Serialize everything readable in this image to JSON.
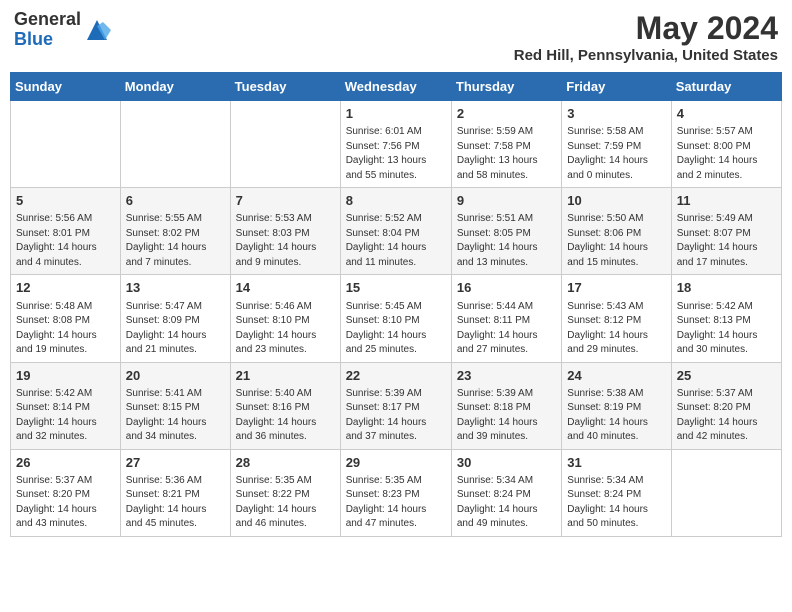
{
  "header": {
    "logo_general": "General",
    "logo_blue": "Blue",
    "month_year": "May 2024",
    "location": "Red Hill, Pennsylvania, United States"
  },
  "days_of_week": [
    "Sunday",
    "Monday",
    "Tuesday",
    "Wednesday",
    "Thursday",
    "Friday",
    "Saturday"
  ],
  "weeks": [
    [
      {
        "day": "",
        "info": ""
      },
      {
        "day": "",
        "info": ""
      },
      {
        "day": "",
        "info": ""
      },
      {
        "day": "1",
        "info": "Sunrise: 6:01 AM\nSunset: 7:56 PM\nDaylight: 13 hours\nand 55 minutes."
      },
      {
        "day": "2",
        "info": "Sunrise: 5:59 AM\nSunset: 7:58 PM\nDaylight: 13 hours\nand 58 minutes."
      },
      {
        "day": "3",
        "info": "Sunrise: 5:58 AM\nSunset: 7:59 PM\nDaylight: 14 hours\nand 0 minutes."
      },
      {
        "day": "4",
        "info": "Sunrise: 5:57 AM\nSunset: 8:00 PM\nDaylight: 14 hours\nand 2 minutes."
      }
    ],
    [
      {
        "day": "5",
        "info": "Sunrise: 5:56 AM\nSunset: 8:01 PM\nDaylight: 14 hours\nand 4 minutes."
      },
      {
        "day": "6",
        "info": "Sunrise: 5:55 AM\nSunset: 8:02 PM\nDaylight: 14 hours\nand 7 minutes."
      },
      {
        "day": "7",
        "info": "Sunrise: 5:53 AM\nSunset: 8:03 PM\nDaylight: 14 hours\nand 9 minutes."
      },
      {
        "day": "8",
        "info": "Sunrise: 5:52 AM\nSunset: 8:04 PM\nDaylight: 14 hours\nand 11 minutes."
      },
      {
        "day": "9",
        "info": "Sunrise: 5:51 AM\nSunset: 8:05 PM\nDaylight: 14 hours\nand 13 minutes."
      },
      {
        "day": "10",
        "info": "Sunrise: 5:50 AM\nSunset: 8:06 PM\nDaylight: 14 hours\nand 15 minutes."
      },
      {
        "day": "11",
        "info": "Sunrise: 5:49 AM\nSunset: 8:07 PM\nDaylight: 14 hours\nand 17 minutes."
      }
    ],
    [
      {
        "day": "12",
        "info": "Sunrise: 5:48 AM\nSunset: 8:08 PM\nDaylight: 14 hours\nand 19 minutes."
      },
      {
        "day": "13",
        "info": "Sunrise: 5:47 AM\nSunset: 8:09 PM\nDaylight: 14 hours\nand 21 minutes."
      },
      {
        "day": "14",
        "info": "Sunrise: 5:46 AM\nSunset: 8:10 PM\nDaylight: 14 hours\nand 23 minutes."
      },
      {
        "day": "15",
        "info": "Sunrise: 5:45 AM\nSunset: 8:10 PM\nDaylight: 14 hours\nand 25 minutes."
      },
      {
        "day": "16",
        "info": "Sunrise: 5:44 AM\nSunset: 8:11 PM\nDaylight: 14 hours\nand 27 minutes."
      },
      {
        "day": "17",
        "info": "Sunrise: 5:43 AM\nSunset: 8:12 PM\nDaylight: 14 hours\nand 29 minutes."
      },
      {
        "day": "18",
        "info": "Sunrise: 5:42 AM\nSunset: 8:13 PM\nDaylight: 14 hours\nand 30 minutes."
      }
    ],
    [
      {
        "day": "19",
        "info": "Sunrise: 5:42 AM\nSunset: 8:14 PM\nDaylight: 14 hours\nand 32 minutes."
      },
      {
        "day": "20",
        "info": "Sunrise: 5:41 AM\nSunset: 8:15 PM\nDaylight: 14 hours\nand 34 minutes."
      },
      {
        "day": "21",
        "info": "Sunrise: 5:40 AM\nSunset: 8:16 PM\nDaylight: 14 hours\nand 36 minutes."
      },
      {
        "day": "22",
        "info": "Sunrise: 5:39 AM\nSunset: 8:17 PM\nDaylight: 14 hours\nand 37 minutes."
      },
      {
        "day": "23",
        "info": "Sunrise: 5:39 AM\nSunset: 8:18 PM\nDaylight: 14 hours\nand 39 minutes."
      },
      {
        "day": "24",
        "info": "Sunrise: 5:38 AM\nSunset: 8:19 PM\nDaylight: 14 hours\nand 40 minutes."
      },
      {
        "day": "25",
        "info": "Sunrise: 5:37 AM\nSunset: 8:20 PM\nDaylight: 14 hours\nand 42 minutes."
      }
    ],
    [
      {
        "day": "26",
        "info": "Sunrise: 5:37 AM\nSunset: 8:20 PM\nDaylight: 14 hours\nand 43 minutes."
      },
      {
        "day": "27",
        "info": "Sunrise: 5:36 AM\nSunset: 8:21 PM\nDaylight: 14 hours\nand 45 minutes."
      },
      {
        "day": "28",
        "info": "Sunrise: 5:35 AM\nSunset: 8:22 PM\nDaylight: 14 hours\nand 46 minutes."
      },
      {
        "day": "29",
        "info": "Sunrise: 5:35 AM\nSunset: 8:23 PM\nDaylight: 14 hours\nand 47 minutes."
      },
      {
        "day": "30",
        "info": "Sunrise: 5:34 AM\nSunset: 8:24 PM\nDaylight: 14 hours\nand 49 minutes."
      },
      {
        "day": "31",
        "info": "Sunrise: 5:34 AM\nSunset: 8:24 PM\nDaylight: 14 hours\nand 50 minutes."
      },
      {
        "day": "",
        "info": ""
      }
    ]
  ]
}
